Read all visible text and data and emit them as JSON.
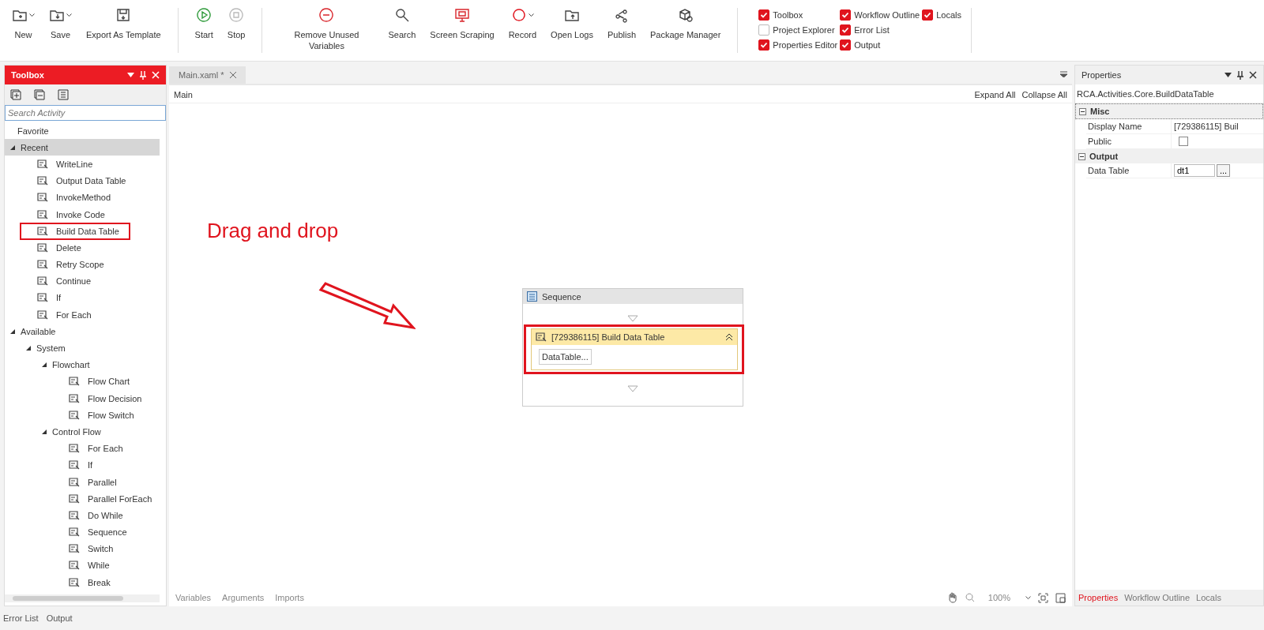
{
  "toolbar": {
    "groups": [
      {
        "buttons": [
          {
            "label": "New",
            "dropdown": true,
            "disabled": false
          },
          {
            "label": "Save",
            "dropdown": true,
            "disabled": false
          },
          {
            "label": "Export As Template",
            "dropdown": false,
            "disabled": false
          }
        ]
      },
      {
        "buttons": [
          {
            "label": "Start",
            "dropdown": false,
            "disabled": false
          },
          {
            "label": "Stop",
            "dropdown": false,
            "disabled": true
          }
        ]
      },
      {
        "buttons": [
          {
            "label": "Remove Unused Variables",
            "dropdown": false,
            "disabled": false
          },
          {
            "label": "Search",
            "dropdown": false,
            "disabled": false
          },
          {
            "label": "Screen Scraping",
            "dropdown": false,
            "disabled": false
          },
          {
            "label": "Record",
            "dropdown": true,
            "disabled": false
          },
          {
            "label": "Open Logs",
            "dropdown": false,
            "disabled": false
          },
          {
            "label": "Publish",
            "dropdown": false,
            "disabled": false
          },
          {
            "label": "Package Manager",
            "dropdown": false,
            "disabled": false
          }
        ]
      }
    ],
    "panels": [
      {
        "label": "Toolbox",
        "checked": true
      },
      {
        "label": "Project Explorer",
        "checked": false
      },
      {
        "label": "Properties Editor",
        "checked": true
      },
      {
        "label": "Workflow Outline",
        "checked": true
      },
      {
        "label": "Error List",
        "checked": true
      },
      {
        "label": "Output",
        "checked": true
      },
      {
        "label": "Locals",
        "checked": true
      }
    ]
  },
  "toolbox": {
    "title": "Toolbox",
    "search": {
      "placeholder": "Search Activity"
    },
    "tree": [
      {
        "label": "Favorite",
        "selected": false
      },
      {
        "label": "Recent",
        "selected": true,
        "expanded": true,
        "children": [
          {
            "label": "WriteLine",
            "selected": false,
            "highlighted": false
          },
          {
            "label": "Output Data Table",
            "selected": false,
            "highlighted": false
          },
          {
            "label": "InvokeMethod",
            "selected": false,
            "highlighted": false
          },
          {
            "label": "Invoke Code",
            "selected": false,
            "highlighted": false
          },
          {
            "label": "Build Data Table",
            "selected": false,
            "highlighted": true
          },
          {
            "label": "Delete",
            "selected": false,
            "highlighted": false
          },
          {
            "label": "Retry Scope",
            "selected": false,
            "highlighted": false
          },
          {
            "label": "Continue",
            "selected": false,
            "highlighted": false
          },
          {
            "label": "If",
            "selected": false,
            "highlighted": false
          },
          {
            "label": "For Each",
            "selected": false,
            "highlighted": false
          }
        ]
      },
      {
        "label": "Available",
        "selected": false,
        "expanded": true,
        "children": [
          {
            "label": "System",
            "selected": false,
            "expanded": true,
            "children": [
              {
                "label": "Flowchart",
                "selected": false,
                "expanded": true,
                "children": [
                  {
                    "label": "Flow Chart",
                    "selected": false
                  },
                  {
                    "label": "Flow Decision",
                    "selected": false
                  },
                  {
                    "label": "Flow Switch",
                    "selected": false
                  }
                ]
              },
              {
                "label": "Control Flow",
                "selected": false,
                "expanded": true,
                "children": [
                  {
                    "label": "For Each",
                    "selected": false
                  },
                  {
                    "label": "If",
                    "selected": false
                  },
                  {
                    "label": "Parallel",
                    "selected": false
                  },
                  {
                    "label": "Parallel ForEach",
                    "selected": false
                  },
                  {
                    "label": "Do While",
                    "selected": false
                  },
                  {
                    "label": "Sequence",
                    "selected": false
                  },
                  {
                    "label": "Switch",
                    "selected": false
                  },
                  {
                    "label": "While",
                    "selected": false
                  },
                  {
                    "label": "Break",
                    "selected": false
                  }
                ]
              }
            ]
          }
        ]
      }
    ]
  },
  "designer": {
    "tabs": [
      {
        "label": "Main.xaml *",
        "selected": true
      }
    ],
    "breadcrumb": "Main",
    "links": [
      "Expand All",
      "Collapse All"
    ],
    "annotation": "Drag and drop",
    "sequence": {
      "title": "Sequence",
      "activity": {
        "title": "[729386115] Build Data Table",
        "button": "DataTable...",
        "highlighted": true
      }
    },
    "bottom_tabs": [
      "Variables",
      "Arguments",
      "Imports"
    ],
    "zoom": "100%"
  },
  "properties": {
    "title": "Properties",
    "type": "RCA.Activities.Core.BuildDataTable",
    "categories": [
      {
        "name": "Misc",
        "expanded": true,
        "rows": [
          {
            "kind": "text",
            "name": "Display Name",
            "value": "[729386115] Buil"
          },
          {
            "kind": "checkbox",
            "name": "Public",
            "checked": false
          }
        ]
      },
      {
        "name": "Output",
        "expanded": true,
        "rows": [
          {
            "kind": "input",
            "name": "Data Table",
            "value": "dt1",
            "button": "..."
          }
        ]
      }
    ],
    "tabs": [
      {
        "label": "Properties",
        "selected": true
      },
      {
        "label": "Workflow Outline",
        "selected": false
      },
      {
        "label": "Locals",
        "selected": false
      }
    ]
  },
  "status_bar": [
    "Error List",
    "Output"
  ]
}
